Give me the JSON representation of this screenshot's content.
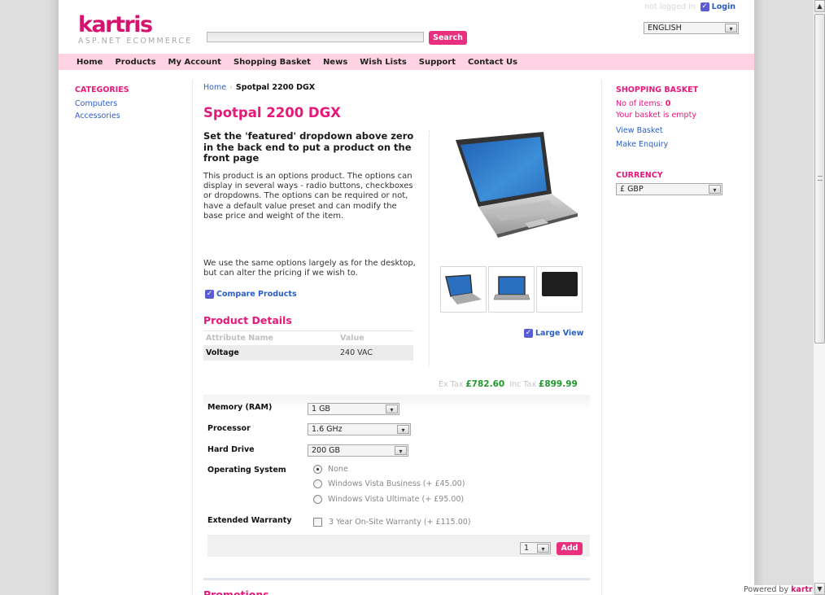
{
  "header": {
    "logo_brand": "kartris",
    "logo_tagline": "ASP.NET ECOMMERCE",
    "search_value": "",
    "search_button": "Search",
    "login_status": "not logged in",
    "login_link": "Login",
    "language_selected": "ENGLISH"
  },
  "nav": [
    "Home",
    "Products",
    "My Account",
    "Shopping Basket",
    "News",
    "Wish Lists",
    "Support",
    "Contact Us"
  ],
  "categories": {
    "title": "CATEGORIES",
    "items": [
      "Computers",
      "Accessories"
    ]
  },
  "breadcrumb": {
    "home": "Home",
    "separator": "›",
    "current": "Spotpal 2200 DGX"
  },
  "product": {
    "title": "Spotpal 2200 DGX",
    "featured_note": "Set the 'featured' dropdown above zero in the back end to put a product on the front page",
    "description": "This product is an options product. The options can display in several ways - radio buttons, checkboxes or dropdowns. The options can be required or not, have a default value preset and can modify the base price and weight of the item.",
    "description2": "We use the same options largely as for the desktop, but can alter the pricing if we wish to.",
    "compare_label": "Compare Products",
    "large_view_label": "Large View",
    "details_title": "Product Details",
    "details_headers": {
      "name": "Attribute Name",
      "value": "Value"
    },
    "details_rows": [
      {
        "name": "Voltage",
        "value": "240 VAC"
      }
    ],
    "price": {
      "ex_tax_label": "Ex Tax",
      "ex_tax": "£782.60",
      "inc_tax_label": "Inc Tax",
      "inc_tax": "£899.99"
    },
    "options": {
      "memory": {
        "label": "Memory (RAM)",
        "selected": "1 GB"
      },
      "processor": {
        "label": "Processor",
        "selected": "1.6 GHz"
      },
      "hard_drive": {
        "label": "Hard Drive",
        "selected": "200 GB"
      },
      "os": {
        "label": "Operating System",
        "choices": [
          "None",
          "Windows Vista Business (+ £45.00)",
          "Windows Vista Ultimate (+ £95.00)"
        ],
        "selected_index": 0
      },
      "warranty": {
        "label": "Extended Warranty",
        "choice": "3 Year On-Site Warranty (+ £115.00)",
        "checked": false
      }
    },
    "quantity": "1",
    "add_button": "Add",
    "promotions_title": "Promotions"
  },
  "basket": {
    "title": "SHOPPING BASKET",
    "items_label": "No of items:",
    "items_count": "0",
    "empty_text": "Your basket is empty",
    "view_basket": "View Basket",
    "make_enquiry": "Make Enquiry"
  },
  "currency": {
    "title": "CURRENCY",
    "selected": "£ GBP"
  },
  "footer": {
    "powered_by": "Powered by",
    "brand": "kartris"
  },
  "colors": {
    "brand_pink": "#e6187a",
    "nav_bg": "#ffd3e3",
    "link_blue": "#2b5ec6",
    "price_green": "#1f9a2a"
  }
}
